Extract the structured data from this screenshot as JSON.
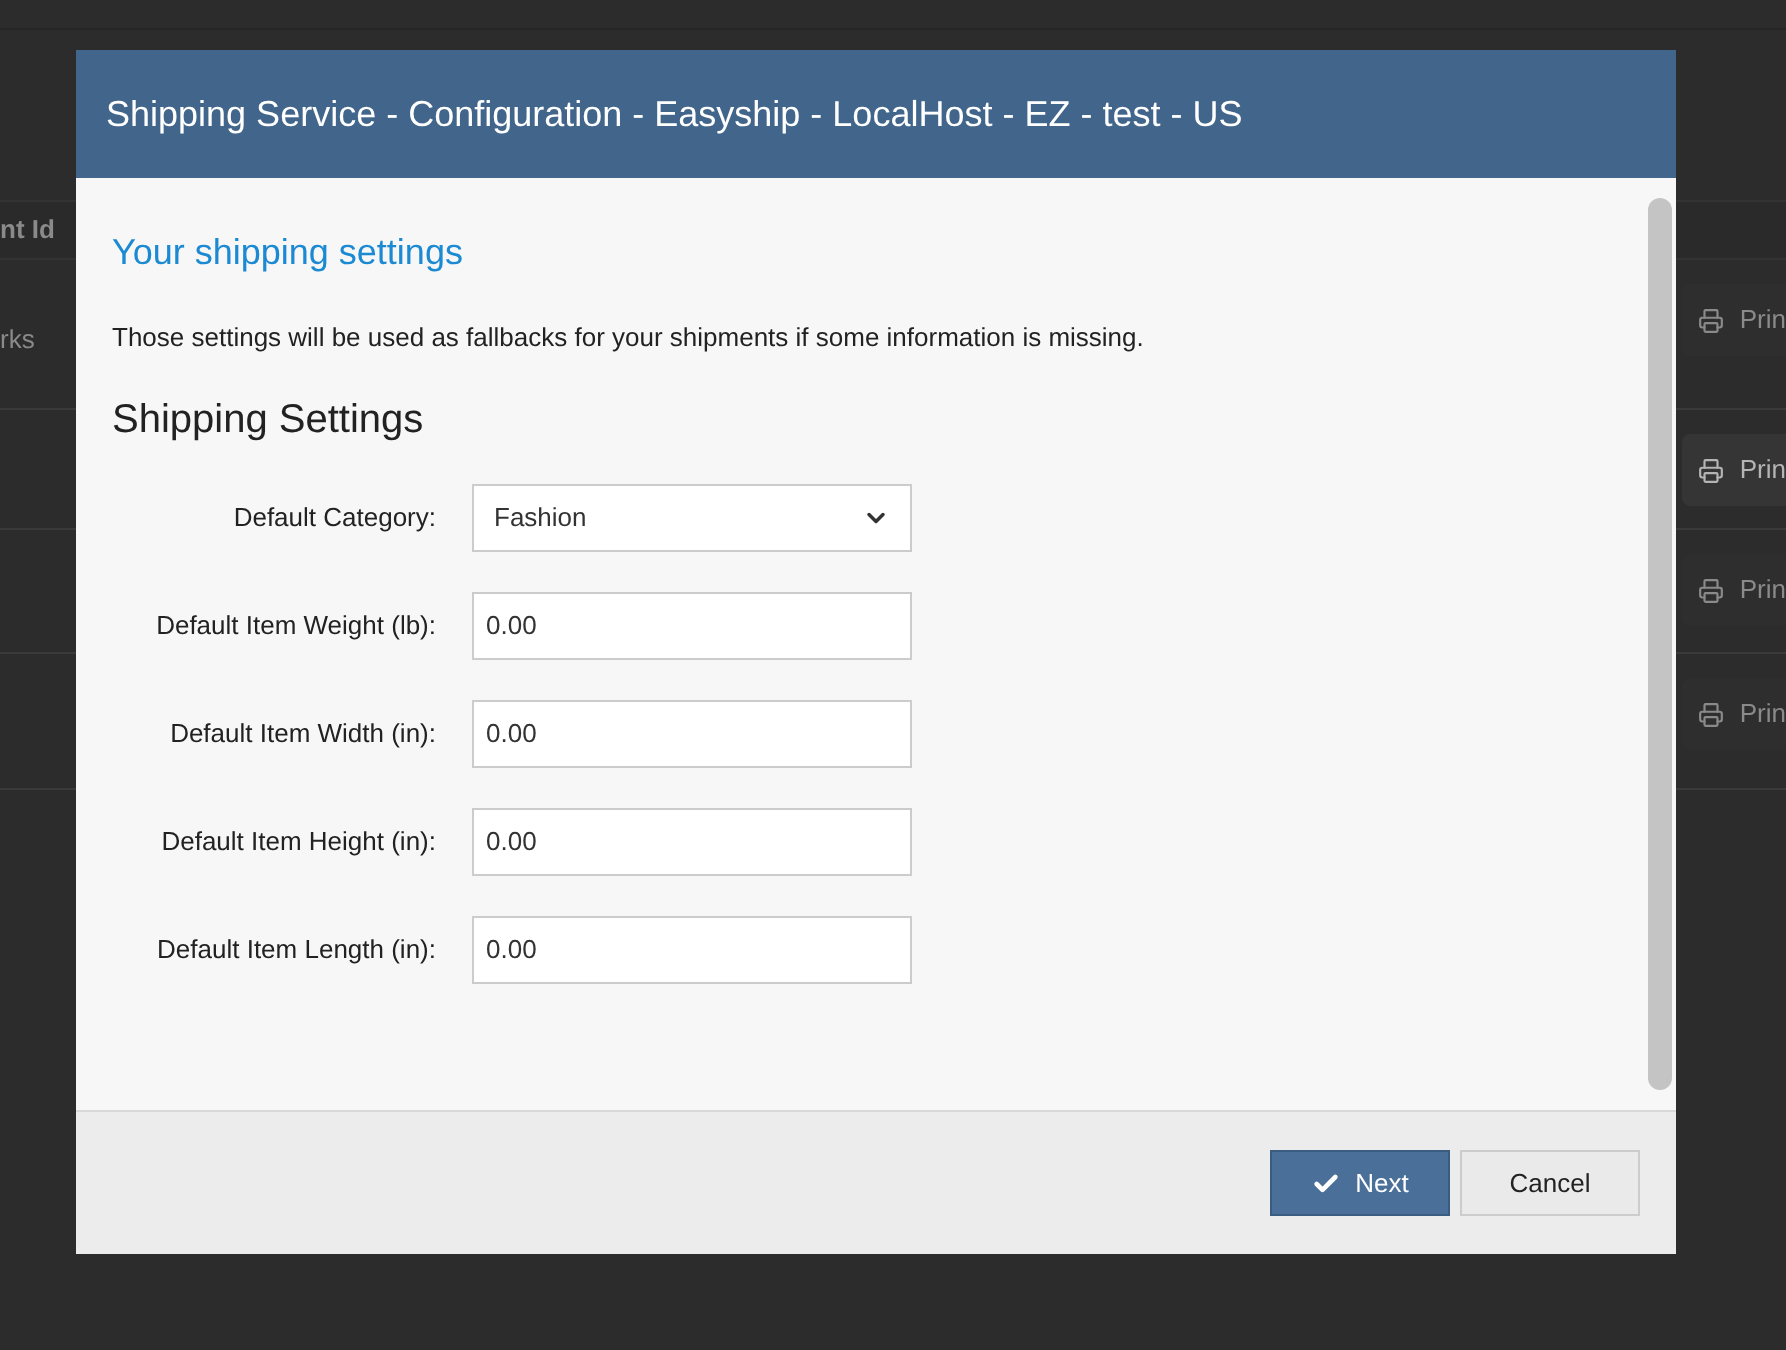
{
  "background_table": {
    "header": "nt Id",
    "rows": [
      {
        "cell": "rks",
        "action": "Prin",
        "disabled": true
      },
      {
        "cell": "",
        "action": "Prin",
        "disabled": false
      },
      {
        "cell": "",
        "action": "Prin",
        "disabled": true
      },
      {
        "cell": "",
        "action": "Prin",
        "disabled": true
      }
    ]
  },
  "dialog": {
    "title": "Shipping Service - Configuration - Easyship - LocalHost - EZ - test - US",
    "heading": "Your shipping settings",
    "description": "Those settings will be used as fallbacks for your shipments if some information is missing.",
    "section_title": "Shipping Settings",
    "fields": [
      {
        "kind": "select",
        "label": "Default Category:",
        "value": "Fashion"
      },
      {
        "kind": "text",
        "label": "Default Item Weight (lb):",
        "value": "0.00"
      },
      {
        "kind": "text",
        "label": "Default Item Width (in):",
        "value": "0.00"
      },
      {
        "kind": "text",
        "label": "Default Item Height (in):",
        "value": "0.00"
      },
      {
        "kind": "text",
        "label": "Default Item Length (in):",
        "value": "0.00"
      }
    ],
    "buttons": [
      {
        "kind": "primary",
        "label": "Next"
      },
      {
        "kind": "secondary",
        "label": "Cancel"
      }
    ]
  }
}
